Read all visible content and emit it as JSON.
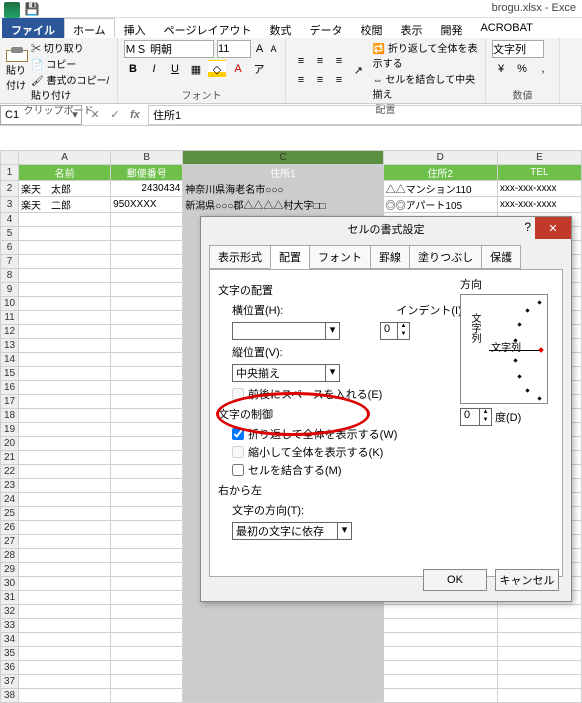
{
  "titlebar": {
    "text": "brogu.xlsx - Exce"
  },
  "tabs": {
    "file": "ファイル",
    "home": "ホーム",
    "insert": "挿入",
    "pagelayout": "ページレイアウト",
    "formulas": "数式",
    "data": "データ",
    "review": "校閲",
    "view": "表示",
    "dev": "開発",
    "acrobat": "ACROBAT"
  },
  "ribbon": {
    "paste": "貼り付け",
    "cut": "切り取り",
    "copy": "コピー",
    "formatpainter": "書式のコピー/貼り付け",
    "clipboard_label": "クリップボード",
    "font_name": "ＭＳ 明朝",
    "font_size": "11",
    "font_label": "フォント",
    "align_label": "配置",
    "wrap": "折り返して全体を表示する",
    "merge": "セルを結合して中央揃え",
    "numfmt": "文字列",
    "num_label": "数値"
  },
  "namebox": "C1",
  "formula": "住所1",
  "cols": {
    "A": "A",
    "B": "B",
    "C": "C",
    "D": "D",
    "E": "E"
  },
  "headers": {
    "A": "名前",
    "B": "郵便番号",
    "C": "住所1",
    "D": "住所2",
    "E": "TEL"
  },
  "rows": [
    {
      "A": "楽天　太郎",
      "B": "2430434",
      "C": "神奈川県海老名市○○○",
      "D": "△△マンション110",
      "E": "xxx-xxx-xxxx"
    },
    {
      "A": "楽天　二郎",
      "B": "950XXXX",
      "C": "新潟県○○○郡△△△△村大字□□",
      "D": "◎◎アパート105",
      "E": "xxx-xxx-xxxx"
    }
  ],
  "dialog": {
    "title": "セルの書式設定",
    "tabs": {
      "number": "表示形式",
      "align": "配置",
      "font": "フォント",
      "border": "罫線",
      "fill": "塗りつぶし",
      "protect": "保護"
    },
    "text_align": "文字の配置",
    "horiz": "横位置(H):",
    "indent_lbl": "インデント(I):",
    "indent_val": "0",
    "vert": "縦位置(V):",
    "vert_val": "中央揃え",
    "justify_dist": "前後にスペースを入れる(E)",
    "text_ctrl": "文字の制御",
    "wrap": "折り返して全体を表示する(W)",
    "shrink": "縮小して全体を表示する(K)",
    "merge": "セルを結合する(M)",
    "rtl": "右から左",
    "textdir_lbl": "文字の方向(T):",
    "textdir_val": "最初の文字に依存",
    "orientation": "方向",
    "ori_text": "文字列",
    "ori_label": "文字列",
    "deg_val": "0",
    "deg_lbl": "度(D)",
    "ok": "OK",
    "cancel": "キャンセル"
  }
}
